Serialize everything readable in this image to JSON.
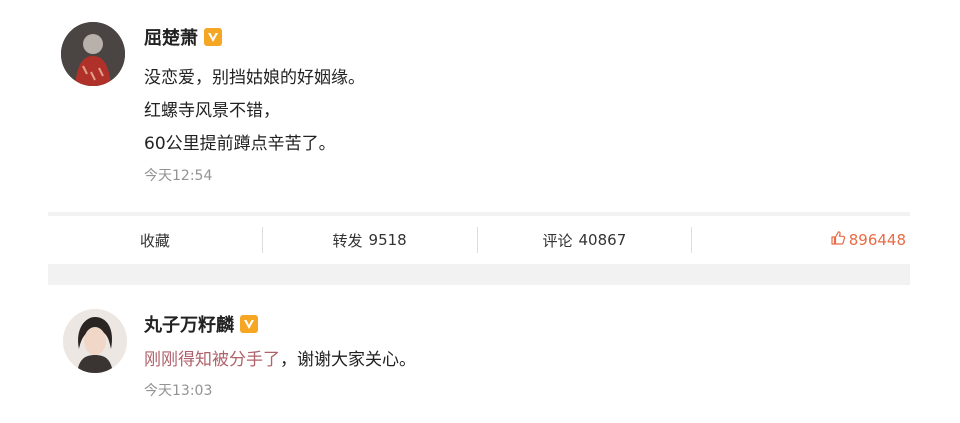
{
  "post1": {
    "user_name": "屈楚萧",
    "lines": [
      "没恋爱，别挡姑娘的好姻缘。",
      "红螺寺风景不错，",
      "60公里提前蹲点辛苦了。"
    ],
    "time": "今天12:54"
  },
  "actions": {
    "favorite_label": "收藏",
    "repost_label": "转发",
    "repost_count": "9518",
    "comment_label": "评论",
    "comment_count": "40867",
    "like_count": "896448"
  },
  "post2": {
    "user_name": "丸子万籽麟",
    "text_highlight": "刚刚得知被分手了",
    "text_rest": "，谢谢大家关心。",
    "time": "今天13:03"
  },
  "icons": {
    "verified": "verified-badge-icon",
    "like": "thumbs-up-icon"
  },
  "colors": {
    "verified_badge": "#f5a623",
    "like": "#e96b45",
    "highlight_text": "#b0626b",
    "timestamp": "#939393"
  }
}
